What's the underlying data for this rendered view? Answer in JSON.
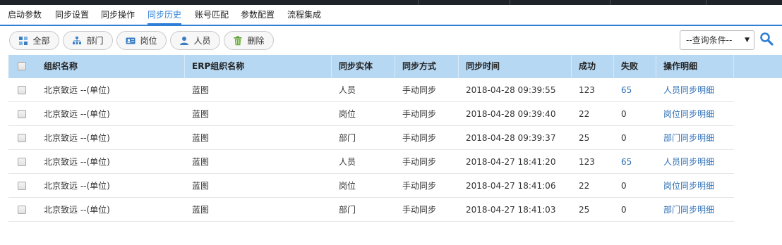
{
  "tabs": [
    {
      "label": "启动参数",
      "active": false
    },
    {
      "label": "同步设置",
      "active": false
    },
    {
      "label": "同步操作",
      "active": false
    },
    {
      "label": "同步历史",
      "active": true
    },
    {
      "label": "账号匹配",
      "active": false
    },
    {
      "label": "参数配置",
      "active": false
    },
    {
      "label": "流程集成",
      "active": false
    }
  ],
  "toolbar": {
    "all_label": "全部",
    "dept_label": "部门",
    "post_label": "岗位",
    "member_label": "人员",
    "delete_label": "删除"
  },
  "query": {
    "selected": "--查询条件--"
  },
  "table": {
    "headers": {
      "org_name": "组织名称",
      "erp_org_name": "ERP组织名称",
      "entity": "同步实体",
      "method": "同步方式",
      "time": "同步时间",
      "success": "成功",
      "fail": "失败",
      "detail": "操作明细"
    },
    "rows": [
      {
        "org_name": "北京致远 --(单位)",
        "erp_org_name": "蓝图",
        "entity": "人员",
        "method": "手动同步",
        "time": "2018-04-28 09:39:55",
        "success": "123",
        "fail": "65",
        "detail": "人员同步明细"
      },
      {
        "org_name": "北京致远 --(单位)",
        "erp_org_name": "蓝图",
        "entity": "岗位",
        "method": "手动同步",
        "time": "2018-04-28 09:39:40",
        "success": "22",
        "fail": "0",
        "detail": "岗位同步明细"
      },
      {
        "org_name": "北京致远 --(单位)",
        "erp_org_name": "蓝图",
        "entity": "部门",
        "method": "手动同步",
        "time": "2018-04-28 09:39:37",
        "success": "25",
        "fail": "0",
        "detail": "部门同步明细"
      },
      {
        "org_name": "北京致远 --(单位)",
        "erp_org_name": "蓝图",
        "entity": "人员",
        "method": "手动同步",
        "time": "2018-04-27 18:41:20",
        "success": "123",
        "fail": "65",
        "detail": "人员同步明细"
      },
      {
        "org_name": "北京致远 --(单位)",
        "erp_org_name": "蓝图",
        "entity": "岗位",
        "method": "手动同步",
        "time": "2018-04-27 18:41:06",
        "success": "22",
        "fail": "0",
        "detail": "岗位同步明细"
      },
      {
        "org_name": "北京致远 --(单位)",
        "erp_org_name": "蓝图",
        "entity": "部门",
        "method": "手动同步",
        "time": "2018-04-27 18:41:03",
        "success": "25",
        "fail": "0",
        "detail": "部门同步明细"
      }
    ]
  },
  "colors": {
    "accent": "#2f7fd6",
    "header_bg": "#b7d8f3",
    "link": "#2f6fb5",
    "topbar": "#1e2329"
  }
}
